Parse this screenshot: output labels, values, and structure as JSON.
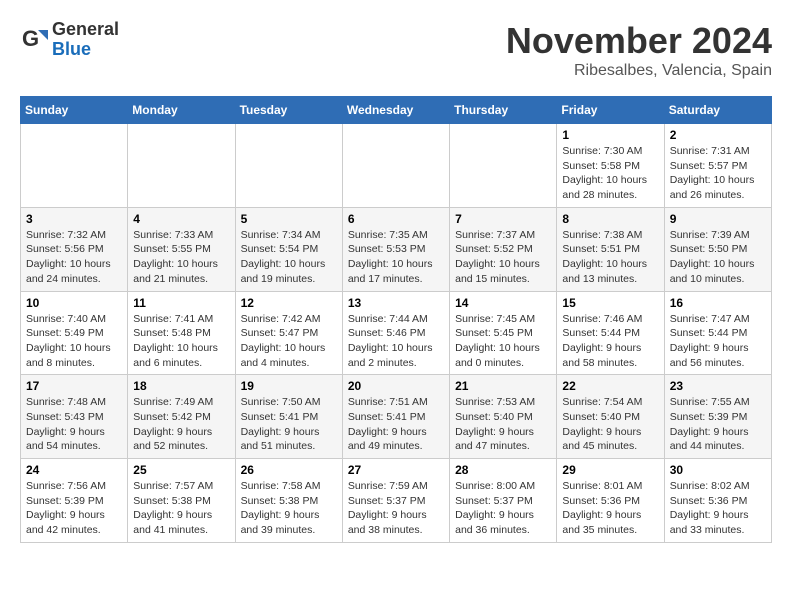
{
  "header": {
    "logo": {
      "general": "General",
      "blue": "Blue"
    },
    "title": "November 2024",
    "location": "Ribesalbes, Valencia, Spain"
  },
  "calendar": {
    "days_of_week": [
      "Sunday",
      "Monday",
      "Tuesday",
      "Wednesday",
      "Thursday",
      "Friday",
      "Saturday"
    ],
    "weeks": [
      [
        {
          "day": "",
          "info": ""
        },
        {
          "day": "",
          "info": ""
        },
        {
          "day": "",
          "info": ""
        },
        {
          "day": "",
          "info": ""
        },
        {
          "day": "",
          "info": ""
        },
        {
          "day": "1",
          "info": "Sunrise: 7:30 AM\nSunset: 5:58 PM\nDaylight: 10 hours and 28 minutes."
        },
        {
          "day": "2",
          "info": "Sunrise: 7:31 AM\nSunset: 5:57 PM\nDaylight: 10 hours and 26 minutes."
        }
      ],
      [
        {
          "day": "3",
          "info": "Sunrise: 7:32 AM\nSunset: 5:56 PM\nDaylight: 10 hours and 24 minutes."
        },
        {
          "day": "4",
          "info": "Sunrise: 7:33 AM\nSunset: 5:55 PM\nDaylight: 10 hours and 21 minutes."
        },
        {
          "day": "5",
          "info": "Sunrise: 7:34 AM\nSunset: 5:54 PM\nDaylight: 10 hours and 19 minutes."
        },
        {
          "day": "6",
          "info": "Sunrise: 7:35 AM\nSunset: 5:53 PM\nDaylight: 10 hours and 17 minutes."
        },
        {
          "day": "7",
          "info": "Sunrise: 7:37 AM\nSunset: 5:52 PM\nDaylight: 10 hours and 15 minutes."
        },
        {
          "day": "8",
          "info": "Sunrise: 7:38 AM\nSunset: 5:51 PM\nDaylight: 10 hours and 13 minutes."
        },
        {
          "day": "9",
          "info": "Sunrise: 7:39 AM\nSunset: 5:50 PM\nDaylight: 10 hours and 10 minutes."
        }
      ],
      [
        {
          "day": "10",
          "info": "Sunrise: 7:40 AM\nSunset: 5:49 PM\nDaylight: 10 hours and 8 minutes."
        },
        {
          "day": "11",
          "info": "Sunrise: 7:41 AM\nSunset: 5:48 PM\nDaylight: 10 hours and 6 minutes."
        },
        {
          "day": "12",
          "info": "Sunrise: 7:42 AM\nSunset: 5:47 PM\nDaylight: 10 hours and 4 minutes."
        },
        {
          "day": "13",
          "info": "Sunrise: 7:44 AM\nSunset: 5:46 PM\nDaylight: 10 hours and 2 minutes."
        },
        {
          "day": "14",
          "info": "Sunrise: 7:45 AM\nSunset: 5:45 PM\nDaylight: 10 hours and 0 minutes."
        },
        {
          "day": "15",
          "info": "Sunrise: 7:46 AM\nSunset: 5:44 PM\nDaylight: 9 hours and 58 minutes."
        },
        {
          "day": "16",
          "info": "Sunrise: 7:47 AM\nSunset: 5:44 PM\nDaylight: 9 hours and 56 minutes."
        }
      ],
      [
        {
          "day": "17",
          "info": "Sunrise: 7:48 AM\nSunset: 5:43 PM\nDaylight: 9 hours and 54 minutes."
        },
        {
          "day": "18",
          "info": "Sunrise: 7:49 AM\nSunset: 5:42 PM\nDaylight: 9 hours and 52 minutes."
        },
        {
          "day": "19",
          "info": "Sunrise: 7:50 AM\nSunset: 5:41 PM\nDaylight: 9 hours and 51 minutes."
        },
        {
          "day": "20",
          "info": "Sunrise: 7:51 AM\nSunset: 5:41 PM\nDaylight: 9 hours and 49 minutes."
        },
        {
          "day": "21",
          "info": "Sunrise: 7:53 AM\nSunset: 5:40 PM\nDaylight: 9 hours and 47 minutes."
        },
        {
          "day": "22",
          "info": "Sunrise: 7:54 AM\nSunset: 5:40 PM\nDaylight: 9 hours and 45 minutes."
        },
        {
          "day": "23",
          "info": "Sunrise: 7:55 AM\nSunset: 5:39 PM\nDaylight: 9 hours and 44 minutes."
        }
      ],
      [
        {
          "day": "24",
          "info": "Sunrise: 7:56 AM\nSunset: 5:39 PM\nDaylight: 9 hours and 42 minutes."
        },
        {
          "day": "25",
          "info": "Sunrise: 7:57 AM\nSunset: 5:38 PM\nDaylight: 9 hours and 41 minutes."
        },
        {
          "day": "26",
          "info": "Sunrise: 7:58 AM\nSunset: 5:38 PM\nDaylight: 9 hours and 39 minutes."
        },
        {
          "day": "27",
          "info": "Sunrise: 7:59 AM\nSunset: 5:37 PM\nDaylight: 9 hours and 38 minutes."
        },
        {
          "day": "28",
          "info": "Sunrise: 8:00 AM\nSunset: 5:37 PM\nDaylight: 9 hours and 36 minutes."
        },
        {
          "day": "29",
          "info": "Sunrise: 8:01 AM\nSunset: 5:36 PM\nDaylight: 9 hours and 35 minutes."
        },
        {
          "day": "30",
          "info": "Sunrise: 8:02 AM\nSunset: 5:36 PM\nDaylight: 9 hours and 33 minutes."
        }
      ]
    ]
  }
}
